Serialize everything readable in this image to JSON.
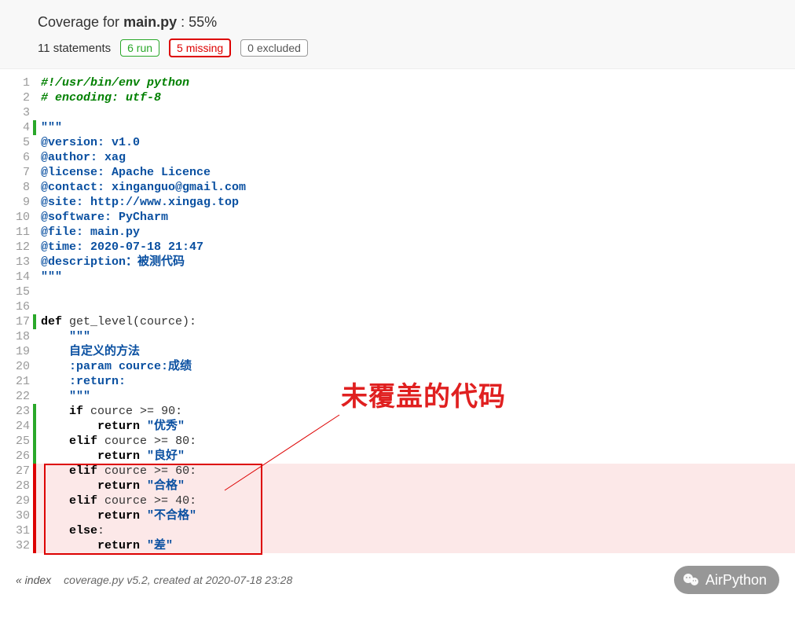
{
  "header": {
    "title_prefix": "Coverage for ",
    "filename": "main.py",
    "title_suffix": " : 55%",
    "statements": "11 statements",
    "run_badge": "6 run",
    "missing_badge": "5 missing",
    "excluded_badge": "0 excluded"
  },
  "annotation": {
    "label": "未覆盖的代码"
  },
  "code": {
    "lines": [
      {
        "n": 1,
        "mark": "",
        "bg": "",
        "html": "<span class='tok-com'>#!/usr/bin/env python</span>"
      },
      {
        "n": 2,
        "mark": "",
        "bg": "",
        "html": "<span class='tok-com'># encoding: utf-8</span>"
      },
      {
        "n": 3,
        "mark": "",
        "bg": "",
        "html": ""
      },
      {
        "n": 4,
        "mark": "run",
        "bg": "",
        "html": "<span class='tok-docstr'>\"\"\"</span>"
      },
      {
        "n": 5,
        "mark": "",
        "bg": "",
        "html": "<span class='tok-docstr'>@version: v1.0</span>"
      },
      {
        "n": 6,
        "mark": "",
        "bg": "",
        "html": "<span class='tok-docstr'>@author: xag</span>"
      },
      {
        "n": 7,
        "mark": "",
        "bg": "",
        "html": "<span class='tok-docstr'>@license: Apache Licence</span>"
      },
      {
        "n": 8,
        "mark": "",
        "bg": "",
        "html": "<span class='tok-docstr'>@contact: xinganguo@gmail.com</span>"
      },
      {
        "n": 9,
        "mark": "",
        "bg": "",
        "html": "<span class='tok-docstr'>@site: http://www.xingag.top</span>"
      },
      {
        "n": 10,
        "mark": "",
        "bg": "",
        "html": "<span class='tok-docstr'>@software: PyCharm</span>"
      },
      {
        "n": 11,
        "mark": "",
        "bg": "",
        "html": "<span class='tok-docstr'>@file: main.py</span>"
      },
      {
        "n": 12,
        "mark": "",
        "bg": "",
        "html": "<span class='tok-docstr'>@time: 2020-07-18 21:47</span>"
      },
      {
        "n": 13,
        "mark": "",
        "bg": "",
        "html": "<span class='tok-docstr'>@description：被测代码</span>"
      },
      {
        "n": 14,
        "mark": "",
        "bg": "",
        "html": "<span class='tok-docstr'>\"\"\"</span>"
      },
      {
        "n": 15,
        "mark": "",
        "bg": "",
        "html": ""
      },
      {
        "n": 16,
        "mark": "",
        "bg": "",
        "html": ""
      },
      {
        "n": 17,
        "mark": "run",
        "bg": "",
        "html": "<span class='tok-kw'>def</span> <span class='tok-def'>get_level(cource):</span>"
      },
      {
        "n": 18,
        "mark": "",
        "bg": "",
        "html": "    <span class='tok-docstr'>\"\"\"</span>"
      },
      {
        "n": 19,
        "mark": "",
        "bg": "",
        "html": "    <span class='tok-docstr'>自定义的方法</span>"
      },
      {
        "n": 20,
        "mark": "",
        "bg": "",
        "html": "    <span class='tok-docstr'>:param cource:成绩</span>"
      },
      {
        "n": 21,
        "mark": "",
        "bg": "",
        "html": "    <span class='tok-docstr'>:return:</span>"
      },
      {
        "n": 22,
        "mark": "",
        "bg": "",
        "html": "    <span class='tok-docstr'>\"\"\"</span>"
      },
      {
        "n": 23,
        "mark": "run",
        "bg": "",
        "html": "    <span class='tok-kw'>if</span> cource &gt;= <span class='tok-num'>90</span>:"
      },
      {
        "n": 24,
        "mark": "run",
        "bg": "",
        "html": "        <span class='tok-kw'>return</span> <span class='tok-str'>\"优秀\"</span>"
      },
      {
        "n": 25,
        "mark": "run",
        "bg": "",
        "html": "    <span class='tok-kw'>elif</span> cource &gt;= <span class='tok-num'>80</span>:"
      },
      {
        "n": 26,
        "mark": "run",
        "bg": "",
        "html": "        <span class='tok-kw'>return</span> <span class='tok-str'>\"良好\"</span>"
      },
      {
        "n": 27,
        "mark": "miss",
        "bg": "miss",
        "html": "    <span class='tok-kw'>elif</span> cource &gt;= <span class='tok-num'>60</span>:"
      },
      {
        "n": 28,
        "mark": "miss",
        "bg": "miss",
        "html": "        <span class='tok-kw'>return</span> <span class='tok-str'>\"合格\"</span>"
      },
      {
        "n": 29,
        "mark": "miss",
        "bg": "miss",
        "html": "    <span class='tok-kw'>elif</span> cource &gt;= <span class='tok-num'>40</span>:"
      },
      {
        "n": 30,
        "mark": "miss",
        "bg": "miss",
        "html": "        <span class='tok-kw'>return</span> <span class='tok-str'>\"不合格\"</span>"
      },
      {
        "n": 31,
        "mark": "miss",
        "bg": "miss",
        "html": "    <span class='tok-kw'>else</span>:"
      },
      {
        "n": 32,
        "mark": "miss",
        "bg": "miss",
        "html": "        <span class='tok-kw'>return</span> <span class='tok-str'>\"差\"</span>"
      }
    ]
  },
  "footer": {
    "index_link": "« index",
    "info": "coverage.py v5.2, created at 2020-07-18 23:28",
    "watermark": "AirPython"
  }
}
